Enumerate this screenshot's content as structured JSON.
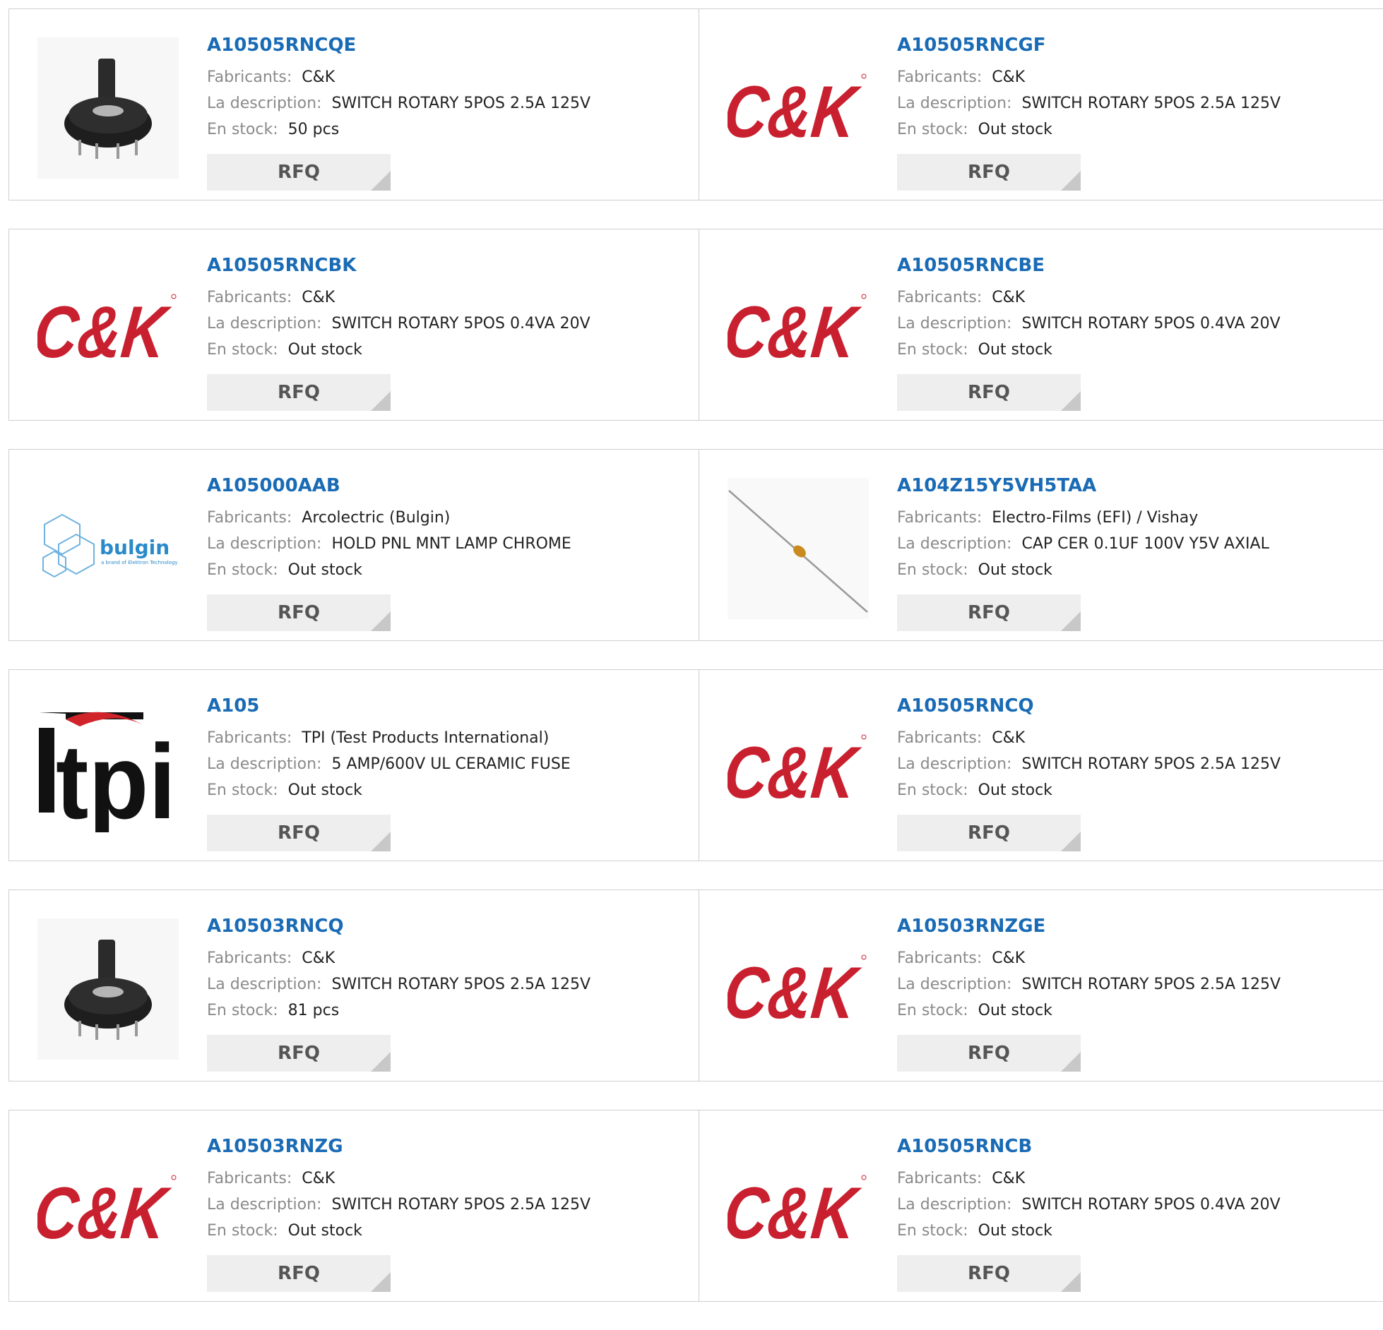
{
  "labels": {
    "manufacturer": "Fabricants:",
    "description": "La description:",
    "stock": "En stock:",
    "rfq": "RFQ"
  },
  "brand_colors": {
    "link": "#1a6bb5",
    "ck_red": "#c8202f",
    "bulgin_blue": "#2a8ac9"
  },
  "products": [
    {
      "part": "A10505RNCQE",
      "manufacturer": "C&K",
      "description": "SWITCH ROTARY 5POS 2.5A 125V",
      "stock": "50 pcs",
      "image": "rotary-switch-photo"
    },
    {
      "part": "A10505RNCGF",
      "manufacturer": "C&K",
      "description": "SWITCH ROTARY 5POS 2.5A 125V",
      "stock": "Out stock",
      "image": "ck-logo"
    },
    {
      "part": "A10505RNCBK",
      "manufacturer": "C&K",
      "description": "SWITCH ROTARY 5POS 0.4VA 20V",
      "stock": "Out stock",
      "image": "ck-logo"
    },
    {
      "part": "A10505RNCBE",
      "manufacturer": "C&K",
      "description": "SWITCH ROTARY 5POS 0.4VA 20V",
      "stock": "Out stock",
      "image": "ck-logo"
    },
    {
      "part": "A105000AAB",
      "manufacturer": "Arcolectric (Bulgin)",
      "description": "HOLD PNL MNT LAMP CHROME",
      "stock": "Out stock",
      "image": "bulgin-logo"
    },
    {
      "part": "A104Z15Y5VH5TAA",
      "manufacturer": "Electro-Films (EFI) / Vishay",
      "description": "CAP CER 0.1UF 100V Y5V AXIAL",
      "stock": "Out stock",
      "image": "axial-capacitor-photo"
    },
    {
      "part": "A105",
      "manufacturer": "TPI (Test Products International)",
      "description": "5 AMP/600V UL CERAMIC FUSE",
      "stock": "Out stock",
      "image": "tpi-logo"
    },
    {
      "part": "A10505RNCQ",
      "manufacturer": "C&K",
      "description": "SWITCH ROTARY 5POS 2.5A 125V",
      "stock": "Out stock",
      "image": "ck-logo"
    },
    {
      "part": "A10503RNCQ",
      "manufacturer": "C&K",
      "description": "SWITCH ROTARY 5POS 2.5A 125V",
      "stock": "81 pcs",
      "image": "rotary-switch-photo"
    },
    {
      "part": "A10503RNZGE",
      "manufacturer": "C&K",
      "description": "SWITCH ROTARY 5POS 2.5A 125V",
      "stock": "Out stock",
      "image": "ck-logo"
    },
    {
      "part": "A10503RNZG",
      "manufacturer": "C&K",
      "description": "SWITCH ROTARY 5POS 2.5A 125V",
      "stock": "Out stock",
      "image": "ck-logo"
    },
    {
      "part": "A10505RNCB",
      "manufacturer": "C&K",
      "description": "SWITCH ROTARY 5POS 0.4VA 20V",
      "stock": "Out stock",
      "image": "ck-logo"
    }
  ],
  "logo_text": {
    "ck": "C&K",
    "bulgin": "bulgin",
    "bulgin_tagline": "a brand of Elektron Technology",
    "tpi": "tpi"
  }
}
